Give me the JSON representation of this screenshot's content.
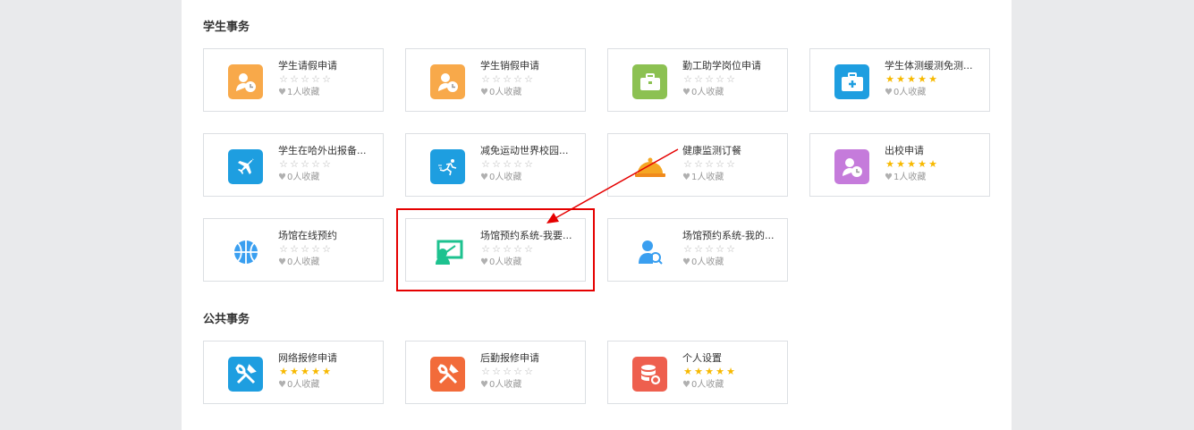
{
  "sections": {
    "student": {
      "title": "学生事务"
    },
    "public": {
      "title": "公共事务"
    }
  },
  "cards": [
    {
      "title": "学生请假申请",
      "rating": 0,
      "favorites": "1人收藏",
      "icon": "user-clock-icon",
      "color": "#f8a94a"
    },
    {
      "title": "学生销假申请",
      "rating": 0,
      "favorites": "0人收藏",
      "icon": "user-clock-icon",
      "color": "#f8a94a"
    },
    {
      "title": "勤工助学岗位申请",
      "rating": 0,
      "favorites": "0人收藏",
      "icon": "briefcase-icon",
      "color": "#8cc152"
    },
    {
      "title": "学生体测缓测免测...",
      "rating": 5,
      "favorites": "0人收藏",
      "icon": "medical-kit-icon",
      "color": "#1e9ee0"
    },
    {
      "title": "学生在哈外出报备...",
      "rating": 0,
      "favorites": "0人收藏",
      "icon": "airplane-icon",
      "color": "#1e9ee0"
    },
    {
      "title": "减免运动世界校园...",
      "rating": 0,
      "favorites": "0人收藏",
      "icon": "running-icon",
      "color": "#1e9ee0"
    },
    {
      "title": "健康监测订餐",
      "rating": 0,
      "favorites": "1人收藏",
      "icon": "food-cloche-icon",
      "color": "#f5a623"
    },
    {
      "title": "出校申请",
      "rating": 5,
      "favorites": "1人收藏",
      "icon": "user-clock-icon",
      "color": "#c57bdb"
    },
    {
      "title": "场馆在线预约",
      "rating": 0,
      "favorites": "0人收藏",
      "icon": "basketball-icon",
      "color": "#3a9ff0"
    },
    {
      "title": "场馆预约系统-我要...",
      "rating": 0,
      "favorites": "0人收藏",
      "icon": "presentation-icon",
      "color": "#1dc28f"
    },
    {
      "title": "场馆预约系统-我的...",
      "rating": 0,
      "favorites": "0人收藏",
      "icon": "user-search-icon",
      "color": "#3a9ff0"
    },
    {
      "title": "网络报修申请",
      "rating": 5,
      "favorites": "0人收藏",
      "icon": "tools-icon",
      "color": "#1e9ee0"
    },
    {
      "title": "后勤报修申请",
      "rating": 0,
      "favorites": "0人收藏",
      "icon": "tools-icon",
      "color": "#f26b3a"
    },
    {
      "title": "个人设置",
      "rating": 5,
      "favorites": "0人收藏",
      "icon": "database-settings-icon",
      "color": "#ee5f4e"
    }
  ],
  "colors": {
    "star_on": "#f7b900",
    "star_off": "#b5b5b5",
    "annotation": "#e50000"
  }
}
